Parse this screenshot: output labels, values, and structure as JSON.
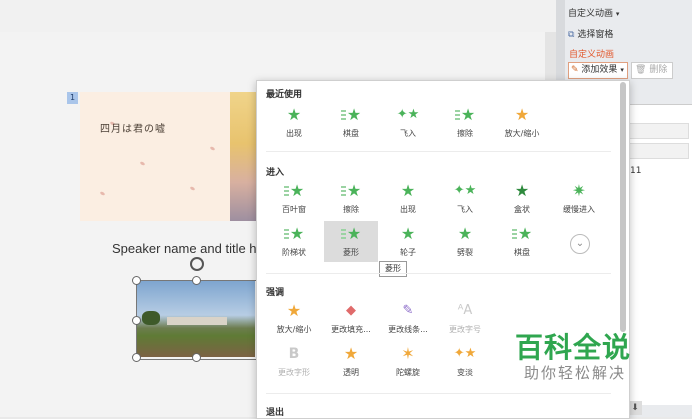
{
  "slide": {
    "number": "1",
    "thumb_title": "四月は君の嘘",
    "speaker_text": "Speaker name and title h"
  },
  "right_panel": {
    "custom_animation_menu": "自定义动画",
    "select_pane": "选择窗格",
    "section_title": "自定义动画",
    "add_effect": "添加效果",
    "delete": "删除",
    "list_fragment": "f 11"
  },
  "popup": {
    "sections": [
      {
        "title": "最近使用",
        "items": [
          {
            "label": "出现",
            "icon": "star-icon",
            "dim": false
          },
          {
            "label": "棋盘",
            "icon": "checker-star-icon",
            "dim": false
          },
          {
            "label": "飞入",
            "icon": "fly-star-icon",
            "dim": false
          },
          {
            "label": "擦除",
            "icon": "wipe-star-icon",
            "dim": false
          },
          {
            "label": "放大/缩小",
            "icon": "grow-star-icon",
            "dim": false
          }
        ]
      },
      {
        "title": "进入",
        "items": [
          {
            "label": "百叶窗",
            "icon": "blinds-star-icon",
            "dim": false
          },
          {
            "label": "擦除",
            "icon": "wipe-star-icon",
            "dim": false
          },
          {
            "label": "出现",
            "icon": "star-icon",
            "dim": false
          },
          {
            "label": "飞入",
            "icon": "fly-star-icon",
            "dim": false
          },
          {
            "label": "盒状",
            "icon": "box-star-icon",
            "dim": false
          },
          {
            "label": "缓慢进入",
            "icon": "crawl-star-icon",
            "dim": false
          },
          {
            "label": "阶梯状",
            "icon": "stairs-star-icon",
            "dim": false
          },
          {
            "label": "菱形",
            "icon": "diamond-star-icon",
            "dim": false,
            "selected": true
          },
          {
            "label": "轮子",
            "icon": "wheel-star-icon",
            "dim": false
          },
          {
            "label": "劈裂",
            "icon": "split-star-icon",
            "dim": false
          },
          {
            "label": "棋盘",
            "icon": "checker-star-icon",
            "dim": false
          }
        ]
      },
      {
        "title": "强调",
        "items": [
          {
            "label": "放大/缩小",
            "icon": "grow-star-icon",
            "dim": false
          },
          {
            "label": "更改填充...",
            "icon": "fill-bucket-icon",
            "dim": false
          },
          {
            "label": "更改线条...",
            "icon": "pen-line-icon",
            "dim": false
          },
          {
            "label": "更改字号",
            "icon": "font-size-icon",
            "dim": true
          },
          {
            "label": "更改字形",
            "icon": "bold-b-icon",
            "dim": true
          },
          {
            "label": "透明",
            "icon": "transparent-star-icon",
            "dim": false
          },
          {
            "label": "陀螺旋",
            "icon": "spin-star-icon",
            "dim": false
          },
          {
            "label": "变淡",
            "icon": "fade-star-icon",
            "dim": false
          }
        ]
      },
      {
        "title": "退出",
        "items": []
      }
    ],
    "tooltip": "菱形"
  },
  "watermark": {
    "line1": "百科全说",
    "line2": "助你轻松解决"
  },
  "colors": {
    "accent_green": "#4bb35a",
    "orange": "#f0a83a",
    "section_title_red": "#e2582d"
  }
}
